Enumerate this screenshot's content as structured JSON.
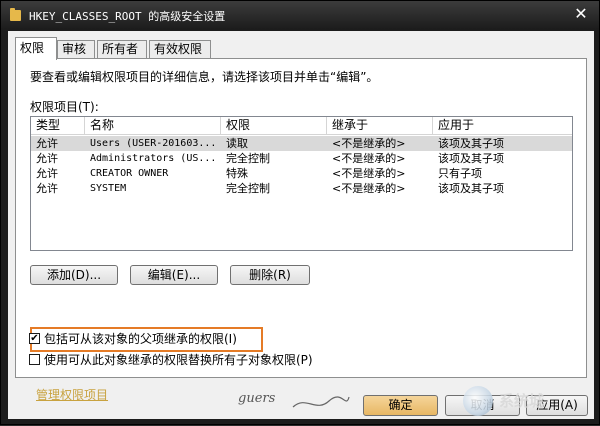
{
  "window": {
    "title": "HKEY_CLASSES_ROOT 的高级安全设置",
    "close_symbol": "✕"
  },
  "tabs": [
    {
      "label": "权限",
      "active": true
    },
    {
      "label": "审核",
      "active": false
    },
    {
      "label": "所有者",
      "active": false
    },
    {
      "label": "有效权限",
      "active": false
    }
  ],
  "instruction": "要查看或编辑权限项目的详细信息，请选择该项目并单击“编辑”。",
  "list_label": "权限项目(T):",
  "columns": [
    "类型",
    "名称",
    "权限",
    "继承于",
    "应用于"
  ],
  "rows": [
    {
      "type": "允许",
      "name": "Users (USER-201603...",
      "permission": "读取",
      "inherited": "<不是继承的>",
      "applies": "该项及其子项",
      "selected": true
    },
    {
      "type": "允许",
      "name": "Administrators (US...",
      "permission": "完全控制",
      "inherited": "<不是继承的>",
      "applies": "该项及其子项",
      "selected": false
    },
    {
      "type": "允许",
      "name": "CREATOR OWNER",
      "permission": "特殊",
      "inherited": "<不是继承的>",
      "applies": "只有子项",
      "selected": false
    },
    {
      "type": "允许",
      "name": "SYSTEM",
      "permission": "完全控制",
      "inherited": "<不是继承的>",
      "applies": "该项及其子项",
      "selected": false
    }
  ],
  "buttons": {
    "add": "添加(D)...",
    "edit": "编辑(E)...",
    "delete": "删除(R)",
    "ok": "确定",
    "cancel": "取消",
    "apply": "应用(A)"
  },
  "checkboxes": {
    "inherit": {
      "label": "包括可从该对象的父项继承的权限(I)",
      "checked": true
    },
    "replace": {
      "label": "使用可从此对象继承的权限替换所有子对象权限(P)",
      "checked": false
    }
  },
  "manage_link": "管理权限项目",
  "watermark": "系统城",
  "signature": "guers"
}
